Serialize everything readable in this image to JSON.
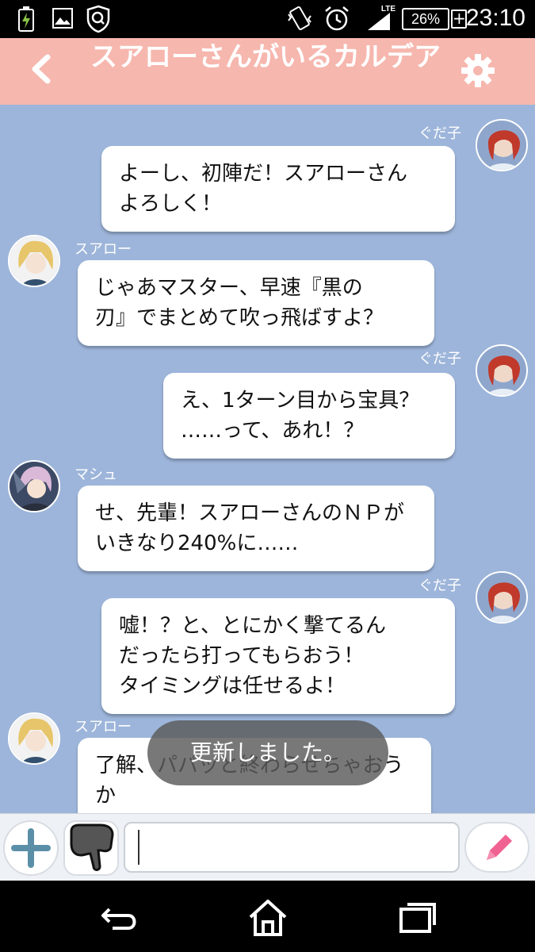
{
  "status_bar": {
    "time": "23:10",
    "battery": "26%",
    "battery_plus": "+",
    "network": "LTE",
    "icons": [
      "battery-charging-icon",
      "gallery-icon",
      "shield-search-icon",
      "vibrate-icon",
      "alarm-icon",
      "signal-icon"
    ]
  },
  "header": {
    "title": "スアローさんがいるカルデア",
    "back_icon": "chevron-left-icon",
    "settings_icon": "gear-icon",
    "color": "#f6b7ae"
  },
  "chat": {
    "background": "#9db5da",
    "messages": [
      {
        "side": "right",
        "name": "ぐだ子",
        "text": "よーし、初陣だ！スアローさん\nよろしく！"
      },
      {
        "side": "left",
        "name": "スアロー",
        "text": "じゃあマスター、早速『黒の\n刃』でまとめて吹っ飛ばすよ？"
      },
      {
        "side": "right",
        "name": "ぐだ子",
        "text": "え、1ターン目から宝具？\n……って、あれ！？"
      },
      {
        "side": "left",
        "name": "マシュ",
        "text": "せ、先輩！スアローさんのＮＰが\nいきなり240%に……"
      },
      {
        "side": "right",
        "name": "ぐだ子",
        "text": "嘘！？と、とにかく撃てるん\nだったら打ってもらおう！\nタイミングは任せるよ！"
      },
      {
        "side": "left",
        "name": "スアロー",
        "text": "了解、パパッと終わらせちゃおうか"
      }
    ]
  },
  "toast": {
    "text": "更新しました。"
  },
  "input_bar": {
    "placeholder": "",
    "plus_icon": "plus-icon",
    "stamp_icon": "thumbs-down-hand-icon",
    "send_icon": "pencil-icon"
  },
  "nav_bar": {
    "icons": [
      "back-icon",
      "home-icon",
      "recents-icon"
    ]
  }
}
